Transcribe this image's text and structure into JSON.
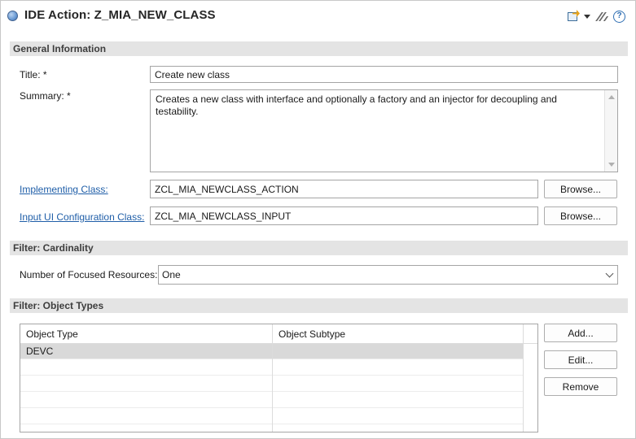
{
  "header": {
    "title": "IDE Action: Z_MIA_NEW_CLASS",
    "icons": [
      "editor-status-icon",
      "run-action-icon",
      "dropdown-icon",
      "annotate-icon",
      "help-icon"
    ],
    "help_glyph": "?"
  },
  "sections": {
    "general": "General Information",
    "cardinality": "Filter: Cardinality",
    "object_types": "Filter: Object Types"
  },
  "general": {
    "title_label": "Title: *",
    "title_value": "Create new class",
    "summary_label": "Summary: *",
    "summary_value": "Creates a new class with interface and optionally a factory and an injector for decoupling and testability.",
    "impl_label": "Implementing Class:",
    "impl_value": "ZCL_MIA_NEWCLASS_ACTION",
    "input_label": "Input UI Configuration Class:",
    "input_value": "ZCL_MIA_NEWCLASS_INPUT",
    "browse_label": "Browse..."
  },
  "cardinality": {
    "label": "Number of Focused Resources:",
    "selected": "One"
  },
  "object_types": {
    "columns": [
      "Object Type",
      "Object Subtype"
    ],
    "rows": [
      {
        "type": "DEVC",
        "subtype": ""
      }
    ],
    "buttons": {
      "add": "Add...",
      "edit": "Edit...",
      "remove": "Remove"
    }
  },
  "colors": {
    "link": "#1f5ea8",
    "section_bg": "#e4e4e4",
    "selected_row": "#d9d9d9"
  }
}
